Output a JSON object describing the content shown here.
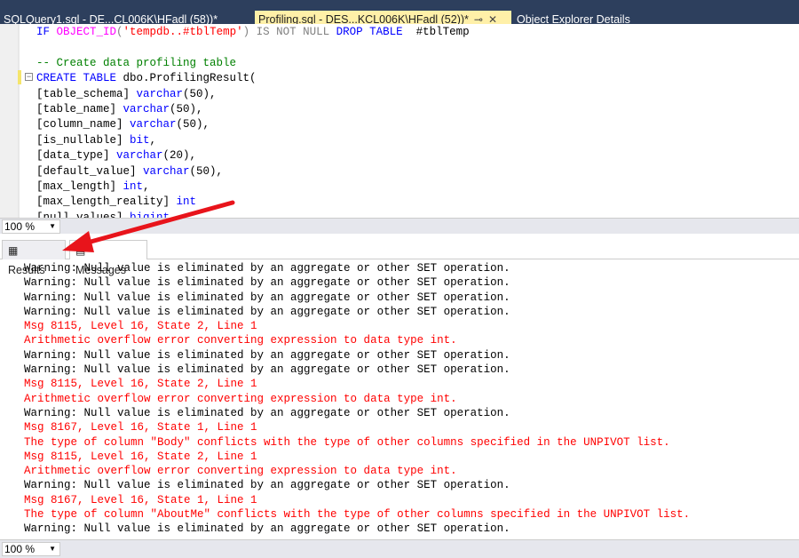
{
  "tabs": [
    {
      "label": "SQLQuery1.sql - DE...CL006K\\HFadl (58))*",
      "active": false
    },
    {
      "label": "Profiling.sql - DES...KCL006K\\HFadl (52))*",
      "active": true,
      "pin": "⊸",
      "close": "✕"
    },
    {
      "label": "Object Explorer Details",
      "active": false
    }
  ],
  "editor": {
    "lines": [
      [
        [
          "kw",
          "IF "
        ],
        [
          "fn",
          "OBJECT_ID"
        ],
        [
          "gr",
          "("
        ],
        [
          "str",
          "'tempdb..#tblTemp'"
        ],
        [
          "gr",
          ") IS NOT NULL "
        ],
        [
          "kw",
          "DROP TABLE"
        ],
        [
          "tx",
          "  #tblTemp"
        ]
      ],
      [],
      [
        [
          "cm",
          "-- Create data profiling table"
        ]
      ],
      [
        [
          "kw",
          "CREATE TABLE "
        ],
        [
          "tx",
          "dbo.ProfilingResult("
        ]
      ],
      [
        [
          "tx",
          "[table_schema] "
        ],
        [
          "kw",
          "varchar"
        ],
        [
          "tx",
          "(50),"
        ]
      ],
      [
        [
          "tx",
          "[table_name] "
        ],
        [
          "kw",
          "varchar"
        ],
        [
          "tx",
          "(50),"
        ]
      ],
      [
        [
          "tx",
          "[column_name] "
        ],
        [
          "kw",
          "varchar"
        ],
        [
          "tx",
          "(50),"
        ]
      ],
      [
        [
          "tx",
          "[is_nullable] "
        ],
        [
          "kw",
          "bit"
        ],
        [
          "tx",
          ","
        ]
      ],
      [
        [
          "tx",
          "[data_type] "
        ],
        [
          "kw",
          "varchar"
        ],
        [
          "tx",
          "(20),"
        ]
      ],
      [
        [
          "tx",
          "[default_value] "
        ],
        [
          "kw",
          "varchar"
        ],
        [
          "tx",
          "(50),"
        ]
      ],
      [
        [
          "tx",
          "[max_length] "
        ],
        [
          "kw",
          "int"
        ],
        [
          "tx",
          ","
        ]
      ],
      [
        [
          "tx",
          "[max_length_reality] "
        ],
        [
          "kw",
          "int"
        ]
      ],
      [
        [
          "tx",
          "[null_values] "
        ],
        [
          "kw",
          "bigint"
        ]
      ]
    ]
  },
  "zoom_top": "100 %",
  "result_tabs": {
    "results": "Results",
    "messages": "Messages"
  },
  "messages": [
    {
      "type": "warn",
      "text": "Warning: Null value is eliminated by an aggregate or other SET operation."
    },
    {
      "type": "warn",
      "text": "Warning: Null value is eliminated by an aggregate or other SET operation."
    },
    {
      "type": "warn",
      "text": "Warning: Null value is eliminated by an aggregate or other SET operation."
    },
    {
      "type": "warn",
      "text": "Warning: Null value is eliminated by an aggregate or other SET operation."
    },
    {
      "type": "err",
      "text": "Msg 8115, Level 16, State 2, Line 1"
    },
    {
      "type": "err",
      "text": "Arithmetic overflow error converting expression to data type int."
    },
    {
      "type": "warn",
      "text": "Warning: Null value is eliminated by an aggregate or other SET operation."
    },
    {
      "type": "warn",
      "text": "Warning: Null value is eliminated by an aggregate or other SET operation."
    },
    {
      "type": "err",
      "text": "Msg 8115, Level 16, State 2, Line 1"
    },
    {
      "type": "err",
      "text": "Arithmetic overflow error converting expression to data type int."
    },
    {
      "type": "warn",
      "text": "Warning: Null value is eliminated by an aggregate or other SET operation."
    },
    {
      "type": "err",
      "text": "Msg 8167, Level 16, State 1, Line 1"
    },
    {
      "type": "err",
      "text": "The type of column \"Body\" conflicts with the type of other columns specified in the UNPIVOT list."
    },
    {
      "type": "err",
      "text": "Msg 8115, Level 16, State 2, Line 1"
    },
    {
      "type": "err",
      "text": "Arithmetic overflow error converting expression to data type int."
    },
    {
      "type": "warn",
      "text": "Warning: Null value is eliminated by an aggregate or other SET operation."
    },
    {
      "type": "err",
      "text": "Msg 8167, Level 16, State 1, Line 1"
    },
    {
      "type": "err",
      "text": "The type of column \"AboutMe\" conflicts with the type of other columns specified in the UNPIVOT list."
    },
    {
      "type": "warn",
      "text": "Warning: Null value is eliminated by an aggregate or other SET operation."
    }
  ],
  "zoom_bottom": "100 %",
  "colors": {
    "keyword": "#0000ff",
    "function": "#ff00ff",
    "string": "#ff0000",
    "comment": "#008000",
    "error": "#ff0000",
    "active_tab": "#fff0a8",
    "tab_bar": "#2d3f5d",
    "arrow": "#e8141b"
  }
}
